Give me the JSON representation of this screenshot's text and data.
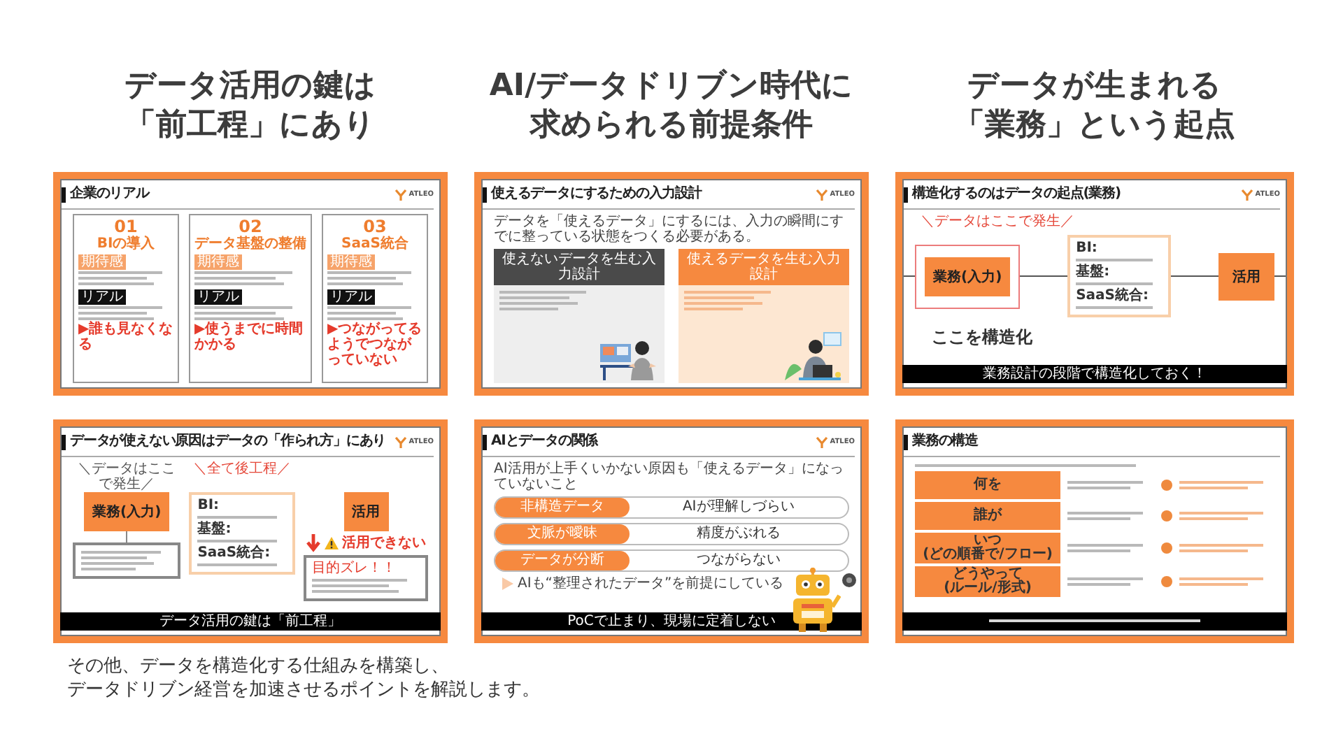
{
  "columns": [
    {
      "heading_lines": [
        "データ活用の鍵は",
        "「前工程」にあり"
      ],
      "slides": [
        {
          "kind": "cards",
          "title": "企業のリアル",
          "logo": "ATLEO",
          "cards": [
            {
              "number": "01",
              "name": "BIの導入",
              "expectation_tag": "期待感",
              "reality_tag": "リアル",
              "result": "▶誰も見なくなる"
            },
            {
              "number": "02",
              "name": "データ基盤の整備",
              "expectation_tag": "期待感",
              "reality_tag": "リアル",
              "result": "▶使うまでに時間かかる"
            },
            {
              "number": "03",
              "name": "SaaS統合",
              "expectation_tag": "期待感",
              "reality_tag": "リアル",
              "result": "▶つながってるようでつながっていない"
            }
          ]
        },
        {
          "kind": "cause_flow",
          "title": "データが使えない原因はデータの「作られ方」にあり",
          "logo": "ATLEO",
          "source_note": "＼データはここで発生／",
          "input_box": "業務(入力)",
          "process_note": "＼全て後工程／",
          "process_labels": [
            "BI:",
            "基盤:",
            "SaaS統合:"
          ],
          "output_box": "活用",
          "warning": "活用できない",
          "result_box_title": "目的ズレ！！",
          "footer": "データ活用の鍵は「前工程」"
        }
      ]
    },
    {
      "heading_lines": [
        "AI/データドリブン時代に",
        "求められる前提条件"
      ],
      "slides": [
        {
          "kind": "compare",
          "title": "使えるデータにするための入力設計",
          "logo": "ATLEO",
          "lead": "データを「使えるデータ」にするには、入力の瞬間にすでに整っている状態をつくる必要がある。",
          "panels": [
            {
              "heading": "使えないデータを生む入力設計",
              "kind": "dark"
            },
            {
              "heading": "使えるデータを生む入力設計",
              "kind": "orange"
            }
          ]
        },
        {
          "kind": "relation",
          "title": "AIとデータの関係",
          "logo": "ATLEO",
          "lead": "AI活用が上手くいかない原因も「使えるデータ」になっていないこと",
          "rows": [
            {
              "cause": "非構造データ",
              "effect": "AIが理解しづらい"
            },
            {
              "cause": "文脈が曖昧",
              "effect": "精度がぶれる"
            },
            {
              "cause": "データが分断",
              "effect": "つながらない"
            }
          ],
          "note": "AIも“整理されたデータ”を前提にしている",
          "footer": "PoCで止まり、現場に定着しない"
        }
      ]
    },
    {
      "heading_lines": [
        "データが生まれる",
        "「業務」という起点"
      ],
      "slides": [
        {
          "kind": "origin_flow",
          "title": "構造化するのはデータの起点(業務)",
          "logo": "ATLEO",
          "source_note": "＼データはここで発生／",
          "input_box": "業務(入力)",
          "process_labels": [
            "BI:",
            "基盤:",
            "SaaS統合:"
          ],
          "output_box": "活用",
          "focus_label": "ここを構造化",
          "footer": "業務設計の段階で構造化しておく！"
        },
        {
          "kind": "structure",
          "title": "業務の構造",
          "rows": [
            {
              "label_lines": [
                "何を"
              ]
            },
            {
              "label_lines": [
                "誰が"
              ]
            },
            {
              "label_lines": [
                "いつ",
                "(どの順番で/フロー)"
              ]
            },
            {
              "label_lines": [
                "どうやって",
                "(ルール/形式)"
              ]
            }
          ]
        }
      ]
    }
  ],
  "caption_lines": [
    "その他、データを構造化する仕組みを構築し、",
    "データドリブン経営を加速させるポイントを解説します。"
  ]
}
